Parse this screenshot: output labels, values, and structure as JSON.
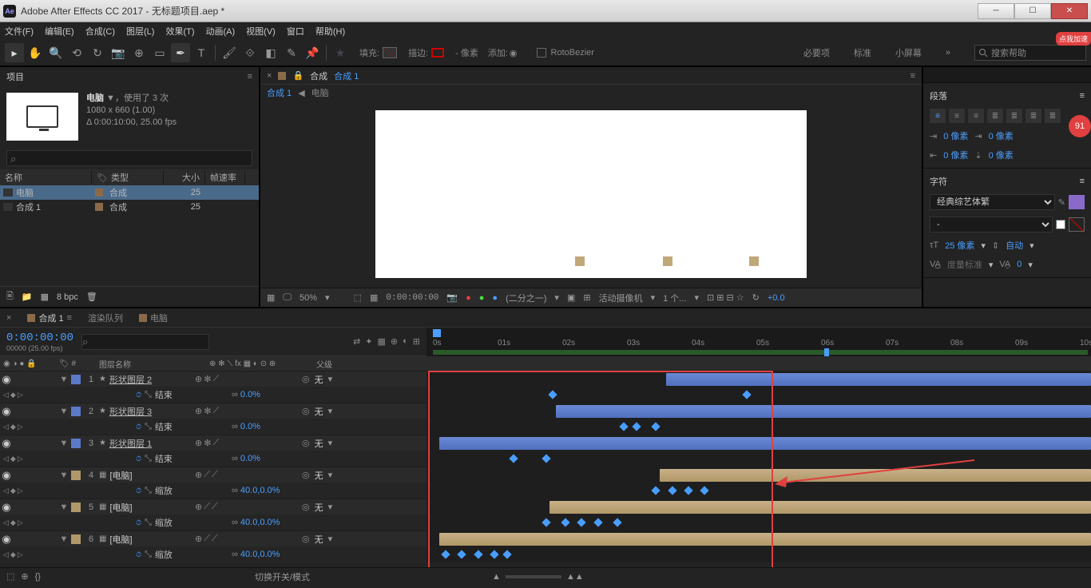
{
  "window": {
    "title": "Adobe After Effects CC 2017 - 无标题项目.aep *"
  },
  "menu": [
    "文件(F)",
    "编辑(E)",
    "合成(C)",
    "图层(L)",
    "效果(T)",
    "动画(A)",
    "视图(V)",
    "窗口",
    "帮助(H)"
  ],
  "toolbar": {
    "fill_label": "填充:",
    "stroke_label": "描边:",
    "px_label": "- 像素",
    "add_label": "添加: ",
    "rotobezier": "RotoBezier",
    "tabs": [
      "必要项",
      "标准",
      "小屏幕"
    ],
    "search_placeholder": "搜索帮助"
  },
  "project": {
    "panel_name": "项目",
    "comp_name": "电脑",
    "comp_used": "，使用了 3 次",
    "comp_res": "1080 x 660 (1.00)",
    "comp_dur": "Δ 0:00:10:00, 25.00 fps",
    "columns": {
      "name": "名称",
      "type": "类型",
      "size": "大小",
      "fps": "帧速率"
    },
    "rows": [
      {
        "name": "电脑",
        "type": "合成",
        "size": "25",
        "selected": true
      },
      {
        "name": "合成 1",
        "type": "合成",
        "size": "25",
        "selected": false
      }
    ],
    "bpc": "8 bpc"
  },
  "comp_viewer": {
    "tab_prefix": "合成",
    "tab_name": "合成 1",
    "breadcrumb": [
      "合成 1",
      "电脑"
    ],
    "zoom": "50%",
    "timecode": "0:00:00:00",
    "res": "(二分之一)",
    "camera": "活动摄像机",
    "views": "1 个...",
    "exposure": "+0.0"
  },
  "right": {
    "paragraph": "段落",
    "indent_px": "0 像素",
    "character": "字符",
    "font": "经典综艺体繁",
    "font_style": "-",
    "size_label": "25 像素",
    "leading": "自动",
    "tracking": "度量标准",
    "badge": "91"
  },
  "timeline": {
    "tabs": [
      {
        "label": "合成 1",
        "active": true
      },
      {
        "label": "渲染队列",
        "active": false
      },
      {
        "label": "电脑",
        "active": false
      }
    ],
    "timecode": "0:00:00:00",
    "subtime": "00000 (25.00 fps)",
    "ruler": [
      "0s",
      "01s",
      "02s",
      "03s",
      "04s",
      "05s",
      "06s",
      "07s",
      "08s",
      "09s",
      "10s"
    ],
    "headers": {
      "name": "图层名称",
      "parent": "父级",
      "toggle": "切换开关/模式"
    },
    "parent_none": "无",
    "layers": [
      {
        "num": 1,
        "name": "形状图层 2",
        "color": "#5a7ac8",
        "type": "shape",
        "prop": "结束",
        "val": "0.0%",
        "bar_start": 36,
        "bar_end": 100,
        "kf": [
          18,
          48
        ]
      },
      {
        "num": 2,
        "name": "形状图层 3",
        "color": "#5a7ac8",
        "type": "shape",
        "prop": "结束",
        "val": "0.0%",
        "bar_start": 19,
        "bar_end": 100,
        "kf": [
          29,
          31,
          34
        ]
      },
      {
        "num": 3,
        "name": "形状图层 1",
        "color": "#5a7ac8",
        "type": "shape",
        "prop": "结束",
        "val": "0.0%",
        "bar_start": 1,
        "bar_end": 100,
        "kf": [
          12,
          17
        ]
      },
      {
        "num": 4,
        "name": "[电脑]",
        "color": "#b09868",
        "type": "comp",
        "prop": "缩放",
        "val": "40.0,0.0%",
        "bar_start": 35,
        "bar_end": 100,
        "kf": [
          34,
          36.5,
          39,
          41.5
        ]
      },
      {
        "num": 5,
        "name": "[电脑]",
        "color": "#b09868",
        "type": "comp",
        "prop": "缩放",
        "val": "40.0,0.0%",
        "bar_start": 18,
        "bar_end": 100,
        "kf": [
          17,
          20,
          22.5,
          25,
          28
        ]
      },
      {
        "num": 6,
        "name": "[电脑]",
        "color": "#b09868",
        "type": "comp",
        "prop": "缩放",
        "val": "40.0,0.0%",
        "bar_start": 1,
        "bar_end": 100,
        "kf": [
          1.5,
          4,
          6.5,
          9,
          11
        ]
      }
    ]
  },
  "annotation": {
    "accelerate": "点我加速"
  }
}
